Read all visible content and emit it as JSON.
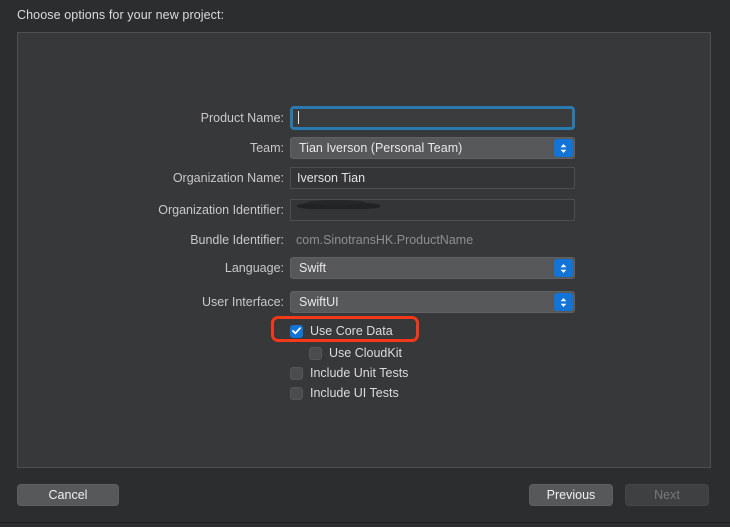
{
  "dialog": {
    "prompt": "Choose options for your new project:"
  },
  "form": {
    "fields": [
      {
        "label": "Product Name:",
        "type": "textfield",
        "value": "",
        "focused": true,
        "redacted": false
      },
      {
        "label": "Team:",
        "type": "popup",
        "value": "Tian Iverson (Personal Team)",
        "focused": false,
        "redacted": false
      },
      {
        "label": "Organization Name:",
        "type": "textfield",
        "value": "Iverson Tian",
        "focused": false,
        "redacted": false
      },
      {
        "label": "Organization Identifier:",
        "type": "textfield",
        "value": "",
        "focused": false,
        "redacted": true
      },
      {
        "label": "Bundle Identifier:",
        "type": "statictext",
        "value": "com.SinotransHK.ProductName",
        "focused": false,
        "redacted": false
      },
      {
        "label": "Language:",
        "type": "popup",
        "value": "Swift",
        "focused": false,
        "redacted": false
      },
      {
        "label": "User Interface:",
        "type": "popup",
        "value": "SwiftUI",
        "focused": false,
        "redacted": false
      }
    ],
    "checkboxes": [
      {
        "label": "Use Core Data",
        "checked": true,
        "indented": false,
        "highlighted": true
      },
      {
        "label": "Use CloudKit",
        "checked": false,
        "indented": true,
        "highlighted": false
      },
      {
        "label": "Include Unit Tests",
        "checked": false,
        "indented": false,
        "highlighted": false
      },
      {
        "label": "Include UI Tests",
        "checked": false,
        "indented": false,
        "highlighted": false
      }
    ]
  },
  "buttons": {
    "cancel": "Cancel",
    "previous": "Previous",
    "next": "Next"
  },
  "colors": {
    "accent_blue": "#1274d6",
    "focus_ring": "#2a7ab0",
    "annotation_red": "#f4381a",
    "panel_bg": "#363839",
    "window_bg": "#2b2d2f"
  }
}
